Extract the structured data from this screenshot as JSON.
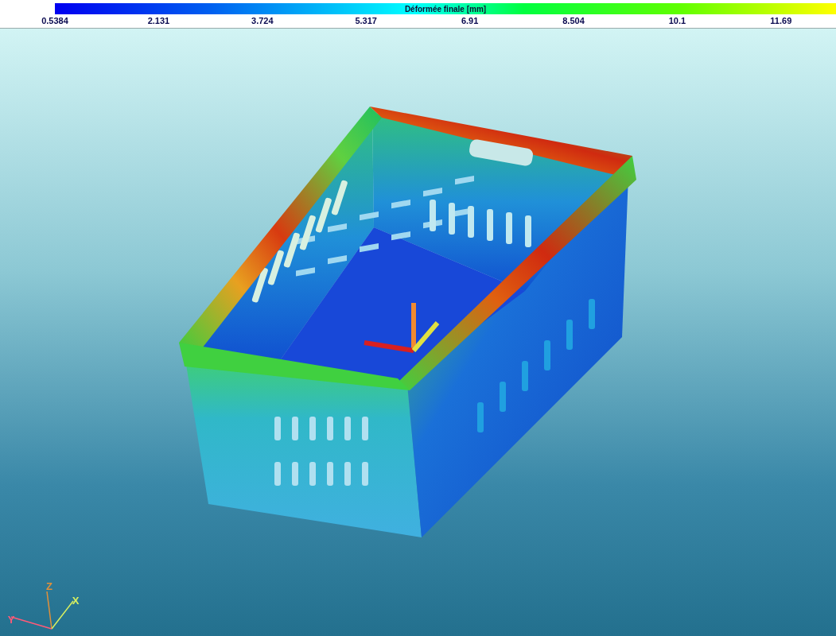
{
  "legend": {
    "title": "Déformée finale [mm]",
    "ticks": [
      "0.5384",
      "2.131",
      "3.724",
      "5.317",
      "6.91",
      "8.504",
      "10.1",
      "11.69"
    ]
  },
  "viewport": {
    "axes": [
      {
        "label": "Z",
        "kind": "z"
      },
      {
        "label": "X",
        "kind": "x"
      },
      {
        "label": "Y",
        "kind": "y"
      }
    ]
  }
}
